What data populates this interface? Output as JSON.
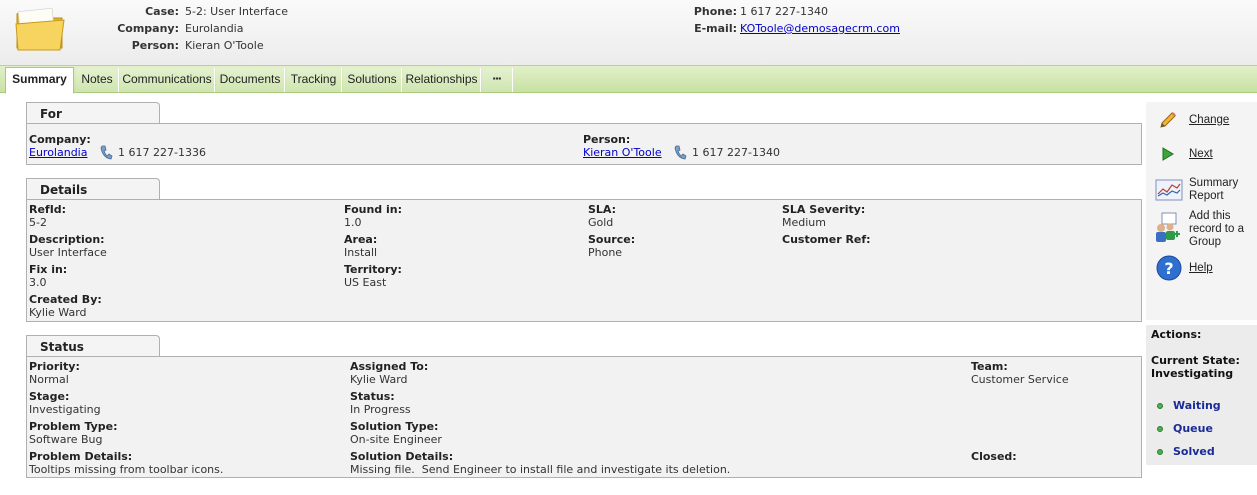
{
  "header": {
    "case_label": "Case:",
    "case_value": "5-2: User Interface",
    "company_label": "Company:",
    "company_value": "Eurolandia",
    "person_label": "Person:",
    "person_value": "Kieran O'Toole",
    "phone_label": "Phone:",
    "phone_value": "1 617 227-1340",
    "email_label": "E-mail:",
    "email_value": "KOToole@demosagecrm.com"
  },
  "tabs": [
    "Summary",
    "Notes",
    "Communications",
    "Documents",
    "Tracking",
    "Solutions",
    "Relationships",
    "▪▪▪"
  ],
  "for_panel": {
    "title": "For",
    "company_label": "Company:",
    "company_value": "Eurolandia",
    "company_phone": "1 617 227-1336",
    "person_label": "Person:",
    "person_value": "Kieran O'Toole",
    "person_phone": "1 617 227-1340"
  },
  "details_panel": {
    "title": "Details",
    "refid_label": "RefId:",
    "refid_value": "5-2",
    "found_in_label": "Found in:",
    "found_in_value": "1.0",
    "sla_label": "SLA:",
    "sla_value": "Gold",
    "sla_severity_label": "SLA Severity:",
    "sla_severity_value": "Medium",
    "description_label": "Description:",
    "description_value": "User Interface",
    "area_label": "Area:",
    "area_value": "Install",
    "source_label": "Source:",
    "source_value": "Phone",
    "customer_ref_label": "Customer Ref:",
    "fix_in_label": "Fix in:",
    "fix_in_value": "3.0",
    "territory_label": "Territory:",
    "territory_value": "US East",
    "created_by_label": "Created By:",
    "created_by_value": "Kylie Ward"
  },
  "status_panel": {
    "title": "Status",
    "priority_label": "Priority:",
    "priority_value": "Normal",
    "assigned_to_label": "Assigned To:",
    "assigned_to_value": "Kylie Ward",
    "team_label": "Team:",
    "team_value": "Customer Service",
    "stage_label": "Stage:",
    "stage_value": "Investigating",
    "status_label": "Status:",
    "status_value": "In Progress",
    "problem_type_label": "Problem Type:",
    "problem_type_value": "Software Bug",
    "solution_type_label": "Solution Type:",
    "solution_type_value": "On-site Engineer",
    "problem_details_label": "Problem Details:",
    "problem_details_value": "Tooltips missing from toolbar icons.",
    "solution_details_label": "Solution Details:",
    "solution_details_value": "Missing file.  Send Engineer to install file and investigate its deletion.",
    "closed_label": "Closed:"
  },
  "sidebar": {
    "change": "Change",
    "next": "Next",
    "summary_report_1": "Summary",
    "summary_report_2": "Report",
    "add_group_1": "Add this",
    "add_group_2": "record to a",
    "add_group_3": "Group",
    "help": "Help"
  },
  "actions": {
    "title": "Actions:",
    "current_state_label": "Current State:",
    "current_state_value": "Investigating",
    "links": [
      "Waiting",
      "Queue",
      "Solved"
    ]
  },
  "colors": {
    "tab_bar": "#c8e1a4",
    "link": "#0000cc",
    "action_link": "#1a2b96",
    "panel_bg": "#f2f2f2"
  }
}
